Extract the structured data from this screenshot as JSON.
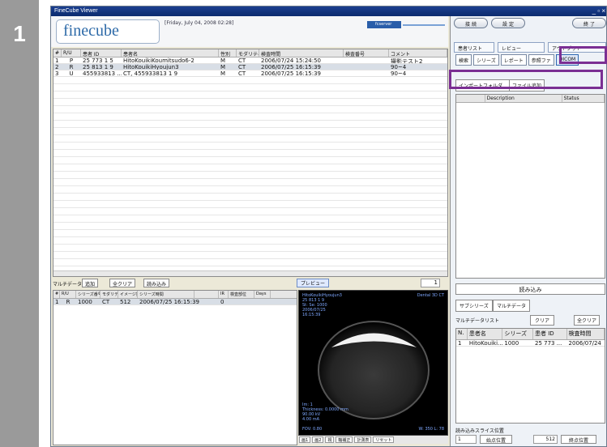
{
  "step": {
    "number": "1"
  },
  "window": {
    "title": "FineCube Viewer",
    "controls": "_ ▫ ×",
    "logo_text": "finecube",
    "date_text": "[Friday, July 04, 2008 02:28]",
    "server_name": "fcserver"
  },
  "study_list": {
    "columns": [
      "#",
      "R/U",
      "患者 ID",
      "患者名",
      "性別",
      "モダリティ",
      "検査時間",
      "検査番号",
      "コメント"
    ],
    "rows": [
      {
        "num": "1",
        "ru": "P",
        "id": "25 773 1 5",
        "name": "HitoKouikiKoumitsudo6-2",
        "sex": "M",
        "mod": "CT",
        "time": "2006/07/24 15:24:50",
        "no": "",
        "comment": "撮影テスト2"
      },
      {
        "num": "2",
        "ru": "R",
        "id": "25 813 1 9",
        "name": "HitoKouikiHyoujun3",
        "sex": "M",
        "mod": "CT",
        "time": "2006/07/25 16:15:39",
        "no": "",
        "comment": "90~4"
      },
      {
        "num": "3",
        "ru": "U",
        "id": "455933813 ...",
        "name": "CT, 455933813 1 9",
        "sex": "M",
        "mod": "CT",
        "time": "2006/07/25 16:15:39",
        "no": "",
        "comment": "90~4"
      }
    ]
  },
  "multi_bar": {
    "label": "マルチデータ",
    "add_label": "追加",
    "clear_label": "全クリア",
    "load_label": "読み込み",
    "preview_label": "プレビュー",
    "page_value": "1"
  },
  "multi_list": {
    "columns": [
      "#",
      "R/U",
      "シリーズ番号",
      "モダリティ",
      "イメージ数",
      "シリーズ時間",
      "",
      "IR",
      "検査部位",
      "Days"
    ],
    "row": {
      "num": "1",
      "ru": "R",
      "series": "1000",
      "mod": "CT",
      "images": "512",
      "time": "2006/07/25 16:15:39",
      "ir": "0"
    }
  },
  "preview": {
    "info": "HitoKouikiHyoujun3\n25 813 1 9\nSt: Se: 1000\n2006/07/25\n16:15:39",
    "title": "Dental 3D CT",
    "info2": "Im: 1\nThickness: 0.0000 mm\n90.00 kV\n4.00 mA",
    "fov": "FOV: 0.80",
    "wl": "W: 350 L: 78",
    "tools": [
      "画1",
      "画2",
      "視",
      "軸補正",
      "計測表",
      "リセット"
    ]
  },
  "right_panel": {
    "connect": "接 続",
    "settings": "設 定",
    "exit": "終 了",
    "tabs": [
      "患者リスト",
      "レビュー",
      "アウトプット"
    ],
    "toolbar": [
      "検索",
      "シリーズ",
      "レポート",
      "参照ファ",
      "DICOM"
    ],
    "import_button": "インポートフォルダ...",
    "second_button": "ファイル追加",
    "import_columns": [
      "",
      "Description",
      "Status"
    ],
    "read_button": "読み込み",
    "sub_tabs": [
      "サブシリーズ",
      "マルチデータ"
    ],
    "mlist_label": "マルチデータリスト",
    "mlist_clear": "クリア",
    "mlist_clear_all": "全クリア",
    "mlist_columns": [
      "N.",
      "患者名",
      "シリーズ",
      "患者 ID",
      "検査時間"
    ],
    "mlist_row": {
      "n": "1",
      "name": "HitoKouiki...",
      "series": "1000",
      "id": "25 773 ...",
      "time": "2006/07/24"
    },
    "slice_label": "読み込みスライス位置",
    "slice_start": "1",
    "slice_start_btn": "始点位置",
    "slice_end": "512",
    "slice_end_btn": "終点位置"
  }
}
